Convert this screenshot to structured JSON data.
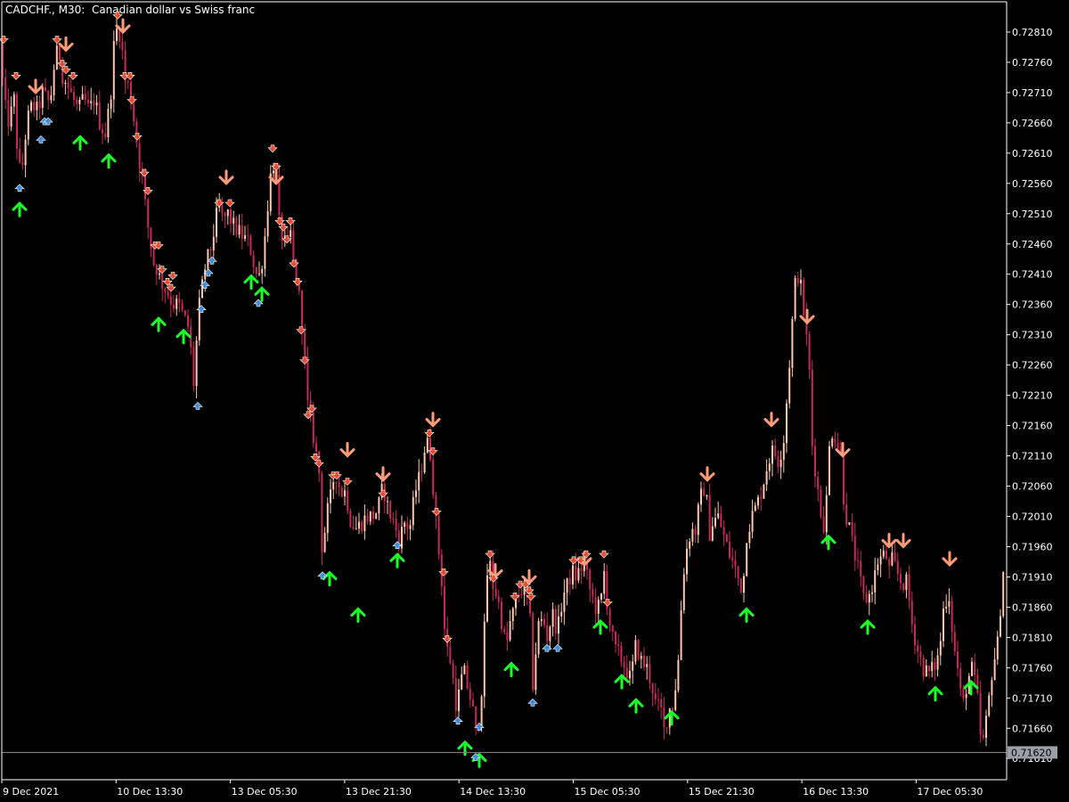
{
  "title": "CADCHF., M30:  Canadian dollar vs Swiss franc",
  "chart_data": {
    "type": "candlestick",
    "symbol": "CADCHF.",
    "timeframe": "M30",
    "ylim": [
      0.71575,
      0.7286
    ],
    "y_ticks": [
      "0.72810",
      "0.72760",
      "0.72710",
      "0.72660",
      "0.72610",
      "0.72560",
      "0.72510",
      "0.72460",
      "0.72410",
      "0.72360",
      "0.72310",
      "0.72260",
      "0.72210",
      "0.72160",
      "0.72110",
      "0.72060",
      "0.72010",
      "0.71960",
      "0.71910",
      "0.71860",
      "0.71810",
      "0.71760",
      "0.71710",
      "0.71660",
      "0.71610"
    ],
    "x_ticks": [
      "9 Dec 2021",
      "10 Dec 13:30",
      "13 Dec 05:30",
      "13 Dec 21:30",
      "14 Dec 13:30",
      "15 Dec 05:30",
      "15 Dec 21:30",
      "16 Dec 13:30",
      "17 Dec 05:30"
    ],
    "current_price": "0.71620",
    "colors": {
      "bull": "#ffc8a8",
      "bear": "#c8285a",
      "background": "#000000",
      "axis": "#ffffff",
      "price_line": "#8a8a8a",
      "sell_large": "#ff9b78",
      "sell_small": "#e84a2a",
      "buy_large": "#18ff28",
      "buy_small": "#3c8cdc"
    },
    "close_path": [
      [
        0,
        0.7279
      ],
      [
        5,
        0.7269
      ],
      [
        10,
        0.7266
      ],
      [
        16,
        0.727
      ],
      [
        20,
        0.726
      ],
      [
        24,
        0.7257
      ],
      [
        30,
        0.7266
      ],
      [
        36,
        0.7269
      ],
      [
        42,
        0.7268
      ],
      [
        48,
        0.7271
      ],
      [
        56,
        0.7269
      ],
      [
        62,
        0.7277
      ],
      [
        66,
        0.7278
      ],
      [
        70,
        0.7274
      ],
      [
        76,
        0.7272
      ],
      [
        82,
        0.727
      ],
      [
        88,
        0.7268
      ],
      [
        94,
        0.727
      ],
      [
        100,
        0.7268
      ],
      [
        106,
        0.727
      ],
      [
        112,
        0.7266
      ],
      [
        118,
        0.7264
      ],
      [
        124,
        0.727
      ],
      [
        128,
        0.7279
      ],
      [
        132,
        0.7282
      ],
      [
        136,
        0.728
      ],
      [
        140,
        0.7273
      ],
      [
        145,
        0.7272
      ],
      [
        150,
        0.7267
      ],
      [
        156,
        0.726
      ],
      [
        160,
        0.7257
      ],
      [
        164,
        0.7251
      ],
      [
        168,
        0.7247
      ],
      [
        172,
        0.7243
      ],
      [
        176,
        0.7242
      ],
      [
        180,
        0.724
      ],
      [
        184,
        0.7239
      ],
      [
        188,
        0.7238
      ],
      [
        194,
        0.7236
      ],
      [
        200,
        0.7236
      ],
      [
        206,
        0.7234
      ],
      [
        212,
        0.7232
      ],
      [
        218,
        0.7222
      ],
      [
        222,
        0.7234
      ],
      [
        226,
        0.7238
      ],
      [
        230,
        0.7242
      ],
      [
        234,
        0.7244
      ],
      [
        238,
        0.7246
      ],
      [
        242,
        0.725
      ],
      [
        246,
        0.7252
      ],
      [
        250,
        0.725
      ],
      [
        256,
        0.7251
      ],
      [
        262,
        0.7249
      ],
      [
        268,
        0.7248
      ],
      [
        274,
        0.7247
      ],
      [
        280,
        0.7246
      ],
      [
        286,
        0.7242
      ],
      [
        290,
        0.724
      ],
      [
        294,
        0.7243
      ],
      [
        298,
        0.7248
      ],
      [
        302,
        0.7255
      ],
      [
        306,
        0.726
      ],
      [
        310,
        0.7257
      ],
      [
        314,
        0.7248
      ],
      [
        318,
        0.7247
      ],
      [
        322,
        0.7245
      ],
      [
        326,
        0.7248
      ],
      [
        330,
        0.7242
      ],
      [
        334,
        0.7239
      ],
      [
        338,
        0.7235
      ],
      [
        342,
        0.7227
      ],
      [
        346,
        0.7218
      ],
      [
        350,
        0.7216
      ],
      [
        354,
        0.7212
      ],
      [
        358,
        0.7209
      ],
      [
        362,
        0.7194
      ],
      [
        366,
        0.7201
      ],
      [
        370,
        0.7203
      ],
      [
        374,
        0.7207
      ],
      [
        378,
        0.7208
      ],
      [
        382,
        0.7205
      ],
      [
        388,
        0.7205
      ],
      [
        394,
        0.72
      ],
      [
        400,
        0.7199
      ],
      [
        406,
        0.72
      ],
      [
        412,
        0.7201
      ],
      [
        418,
        0.7201
      ],
      [
        424,
        0.7202
      ],
      [
        430,
        0.7206
      ],
      [
        436,
        0.7202
      ],
      [
        442,
        0.72
      ],
      [
        448,
        0.7197
      ],
      [
        454,
        0.72
      ],
      [
        460,
        0.7199
      ],
      [
        466,
        0.7205
      ],
      [
        472,
        0.7208
      ],
      [
        476,
        0.7212
      ],
      [
        480,
        0.7213
      ],
      [
        484,
        0.7211
      ],
      [
        488,
        0.7202
      ],
      [
        492,
        0.7196
      ],
      [
        496,
        0.719
      ],
      [
        500,
        0.718
      ],
      [
        506,
        0.7177
      ],
      [
        512,
        0.717
      ],
      [
        516,
        0.7172
      ],
      [
        520,
        0.7176
      ],
      [
        526,
        0.7172
      ],
      [
        530,
        0.717
      ],
      [
        534,
        0.7165
      ],
      [
        538,
        0.7168
      ],
      [
        542,
        0.7175
      ],
      [
        546,
        0.7191
      ],
      [
        550,
        0.7193
      ],
      [
        554,
        0.7189
      ],
      [
        558,
        0.7188
      ],
      [
        564,
        0.7183
      ],
      [
        568,
        0.7179
      ],
      [
        572,
        0.7183
      ],
      [
        576,
        0.7185
      ],
      [
        580,
        0.7188
      ],
      [
        586,
        0.7189
      ],
      [
        590,
        0.7188
      ],
      [
        594,
        0.7187
      ],
      [
        598,
        0.7173
      ],
      [
        604,
        0.7183
      ],
      [
        610,
        0.7184
      ],
      [
        614,
        0.7181
      ],
      [
        620,
        0.7185
      ],
      [
        626,
        0.7182
      ],
      [
        632,
        0.7188
      ],
      [
        638,
        0.719
      ],
      [
        642,
        0.7192
      ],
      [
        646,
        0.7191
      ],
      [
        650,
        0.7192
      ],
      [
        656,
        0.7193
      ],
      [
        662,
        0.7189
      ],
      [
        668,
        0.7186
      ],
      [
        674,
        0.7186
      ],
      [
        678,
        0.7192
      ],
      [
        682,
        0.7186
      ],
      [
        686,
        0.7182
      ],
      [
        690,
        0.7179
      ],
      [
        696,
        0.7178
      ],
      [
        702,
        0.7176
      ],
      [
        708,
        0.7174
      ],
      [
        714,
        0.718
      ],
      [
        720,
        0.7177
      ],
      [
        726,
        0.7176
      ],
      [
        732,
        0.7173
      ],
      [
        736,
        0.717
      ],
      [
        742,
        0.7169
      ],
      [
        746,
        0.7165
      ],
      [
        750,
        0.7169
      ],
      [
        756,
        0.717
      ],
      [
        762,
        0.7178
      ],
      [
        766,
        0.719
      ],
      [
        770,
        0.7195
      ],
      [
        776,
        0.7199
      ],
      [
        780,
        0.7198
      ],
      [
        784,
        0.7202
      ],
      [
        788,
        0.7205
      ],
      [
        792,
        0.7206
      ],
      [
        796,
        0.7198
      ],
      [
        800,
        0.72
      ],
      [
        806,
        0.7201
      ],
      [
        812,
        0.7198
      ],
      [
        818,
        0.7195
      ],
      [
        824,
        0.7193
      ],
      [
        830,
        0.719
      ],
      [
        834,
        0.7189
      ],
      [
        838,
        0.7198
      ],
      [
        844,
        0.7201
      ],
      [
        850,
        0.7203
      ],
      [
        856,
        0.7206
      ],
      [
        862,
        0.721
      ],
      [
        868,
        0.7212
      ],
      [
        874,
        0.721
      ],
      [
        880,
        0.7214
      ],
      [
        884,
        0.7222
      ],
      [
        888,
        0.723
      ],
      [
        892,
        0.7239
      ],
      [
        896,
        0.7241
      ],
      [
        900,
        0.7238
      ],
      [
        904,
        0.7232
      ],
      [
        908,
        0.7227
      ],
      [
        912,
        0.7212
      ],
      [
        916,
        0.7208
      ],
      [
        920,
        0.7203
      ],
      [
        924,
        0.7199
      ],
      [
        928,
        0.7204
      ],
      [
        932,
        0.7215
      ],
      [
        936,
        0.7215
      ],
      [
        940,
        0.7213
      ],
      [
        944,
        0.7211
      ],
      [
        948,
        0.7202
      ],
      [
        952,
        0.72
      ],
      [
        956,
        0.7197
      ],
      [
        962,
        0.7193
      ],
      [
        966,
        0.719
      ],
      [
        970,
        0.7187
      ],
      [
        976,
        0.7188
      ],
      [
        980,
        0.719
      ],
      [
        986,
        0.7194
      ],
      [
        990,
        0.7194
      ],
      [
        994,
        0.7195
      ],
      [
        998,
        0.7192
      ],
      [
        1002,
        0.7194
      ],
      [
        1006,
        0.7192
      ],
      [
        1012,
        0.719
      ],
      [
        1018,
        0.719
      ],
      [
        1024,
        0.7183
      ],
      [
        1030,
        0.7179
      ],
      [
        1036,
        0.7176
      ],
      [
        1042,
        0.7175
      ],
      [
        1048,
        0.7176
      ],
      [
        1054,
        0.7178
      ],
      [
        1060,
        0.7187
      ],
      [
        1066,
        0.7188
      ],
      [
        1070,
        0.718
      ],
      [
        1076,
        0.7175
      ],
      [
        1080,
        0.7169
      ],
      [
        1086,
        0.7174
      ],
      [
        1092,
        0.7176
      ],
      [
        1098,
        0.717
      ],
      [
        1102,
        0.7162
      ],
      [
        1108,
        0.7168
      ],
      [
        1114,
        0.7176
      ],
      [
        1120,
        0.718
      ],
      [
        1126,
        0.7192
      ],
      [
        1128,
        0.7194
      ]
    ],
    "sell_signals_large": [
      [
        40,
        0.7271
      ],
      [
        74,
        0.7278
      ],
      [
        138,
        0.7281
      ],
      [
        254,
        0.7256
      ],
      [
        310,
        0.7256
      ],
      [
        390,
        0.7211
      ],
      [
        430,
        0.7207
      ],
      [
        486,
        0.7216
      ],
      [
        556,
        0.7191
      ],
      [
        594,
        0.719
      ],
      [
        656,
        0.7193
      ],
      [
        794,
        0.7207
      ],
      [
        866,
        0.7216
      ],
      [
        906,
        0.7233
      ],
      [
        946,
        0.7211
      ],
      [
        998,
        0.7196
      ],
      [
        1014,
        0.7196
      ],
      [
        1066,
        0.7193
      ]
    ],
    "sell_signals_small": [
      [
        4,
        0.7279
      ],
      [
        18,
        0.7273
      ],
      [
        64,
        0.7279
      ],
      [
        70,
        0.7275
      ],
      [
        74,
        0.7274
      ],
      [
        82,
        0.7273
      ],
      [
        132,
        0.7283
      ],
      [
        140,
        0.7273
      ],
      [
        146,
        0.7273
      ],
      [
        148,
        0.7269
      ],
      [
        154,
        0.7263
      ],
      [
        162,
        0.7257
      ],
      [
        166,
        0.7254
      ],
      [
        174,
        0.7245
      ],
      [
        178,
        0.7245
      ],
      [
        182,
        0.7241
      ],
      [
        188,
        0.7239
      ],
      [
        192,
        0.7238
      ],
      [
        194,
        0.724
      ],
      [
        246,
        0.7252
      ],
      [
        258,
        0.7252
      ],
      [
        306,
        0.7261
      ],
      [
        310,
        0.7258
      ],
      [
        314,
        0.7249
      ],
      [
        318,
        0.7248
      ],
      [
        322,
        0.7246
      ],
      [
        326,
        0.7249
      ],
      [
        330,
        0.7242
      ],
      [
        334,
        0.7239
      ],
      [
        338,
        0.7231
      ],
      [
        342,
        0.7226
      ],
      [
        346,
        0.7217
      ],
      [
        350,
        0.7218
      ],
      [
        354,
        0.721
      ],
      [
        358,
        0.7209
      ],
      [
        374,
        0.7207
      ],
      [
        378,
        0.7207
      ],
      [
        390,
        0.7206
      ],
      [
        430,
        0.7204
      ],
      [
        482,
        0.7214
      ],
      [
        486,
        0.7211
      ],
      [
        490,
        0.7201
      ],
      [
        498,
        0.7191
      ],
      [
        502,
        0.718
      ],
      [
        550,
        0.7194
      ],
      [
        554,
        0.719
      ],
      [
        578,
        0.7187
      ],
      [
        584,
        0.7189
      ],
      [
        590,
        0.7189
      ],
      [
        594,
        0.7188
      ],
      [
        596,
        0.7187
      ],
      [
        644,
        0.7193
      ],
      [
        652,
        0.7193
      ],
      [
        658,
        0.7194
      ],
      [
        678,
        0.7194
      ],
      [
        682,
        0.7186
      ]
    ],
    "buy_signals_large": [
      [
        22,
        0.7253
      ],
      [
        90,
        0.7264
      ],
      [
        122,
        0.7261
      ],
      [
        178,
        0.7234
      ],
      [
        206,
        0.7232
      ],
      [
        282,
        0.7241
      ],
      [
        294,
        0.7239
      ],
      [
        370,
        0.7192
      ],
      [
        402,
        0.7186
      ],
      [
        446,
        0.7195
      ],
      [
        522,
        0.7164
      ],
      [
        538,
        0.7162
      ],
      [
        574,
        0.7177
      ],
      [
        674,
        0.7184
      ],
      [
        698,
        0.7175
      ],
      [
        714,
        0.7171
      ],
      [
        754,
        0.7169
      ],
      [
        838,
        0.7186
      ],
      [
        930,
        0.7198
      ],
      [
        974,
        0.7184
      ],
      [
        1050,
        0.7173
      ],
      [
        1090,
        0.7174
      ]
    ],
    "buy_signals_small": [
      [
        22,
        0.7256
      ],
      [
        46,
        0.7264
      ],
      [
        50,
        0.7267
      ],
      [
        54,
        0.7267
      ],
      [
        222,
        0.722
      ],
      [
        226,
        0.7236
      ],
      [
        230,
        0.724
      ],
      [
        234,
        0.7242
      ],
      [
        238,
        0.7244
      ],
      [
        290,
        0.7237
      ],
      [
        362,
        0.7192
      ],
      [
        446,
        0.7197
      ],
      [
        514,
        0.7168
      ],
      [
        534,
        0.7162
      ],
      [
        538,
        0.7167
      ],
      [
        598,
        0.7171
      ],
      [
        614,
        0.718
      ],
      [
        626,
        0.718
      ]
    ]
  }
}
